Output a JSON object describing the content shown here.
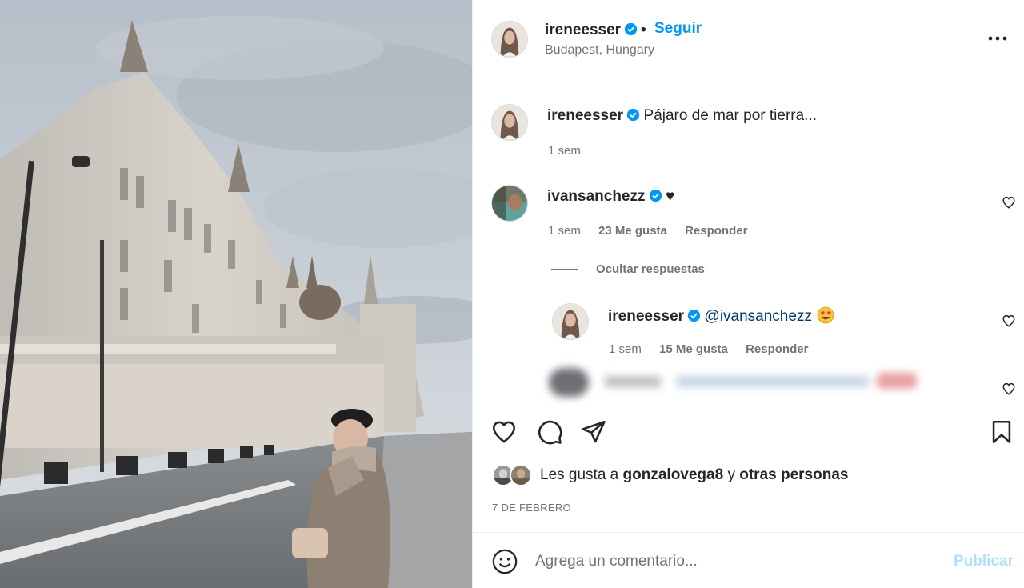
{
  "post": {
    "author": "ireneesser",
    "follow_label": "Seguir",
    "separator": "•",
    "location": "Budapest, Hungary"
  },
  "caption": {
    "user": "ireneesser",
    "text": "Pájaro de mar por tierra...",
    "time": "1 sem"
  },
  "comments": [
    {
      "user": "ivansanchezz",
      "text": "♥",
      "time": "1 sem",
      "likes": "23 Me gusta",
      "reply_label": "Responder"
    }
  ],
  "replies_toggle": "Ocultar respuestas",
  "reply": {
    "user": "ireneesser",
    "mention": "@ivansanchezz",
    "emoji": "heart-eyes-emoji",
    "time": "1 sem",
    "likes": "15 Me gusta",
    "reply_label": "Responder"
  },
  "likes": {
    "prefix": "Les gusta a",
    "user": "gonzalovega8",
    "conj": "y",
    "others": "otras personas"
  },
  "date": "7 DE FEBRERO",
  "composer": {
    "placeholder": "Agrega un comentario...",
    "post_label": "Publicar"
  },
  "icons": [
    "more-options-icon",
    "verified-icon",
    "heart-icon",
    "comment-icon",
    "share-icon",
    "save-icon",
    "smile-icon"
  ],
  "colors": {
    "link_blue": "#0095f6",
    "verified_blue": "#0095f6",
    "text": "#262626",
    "muted": "#737373",
    "publish_disabled": "#b2dffc"
  }
}
